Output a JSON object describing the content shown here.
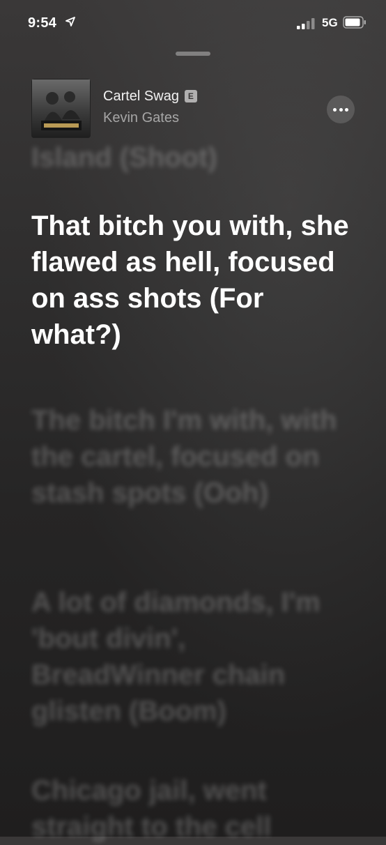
{
  "status_bar": {
    "time": "9:54",
    "network": "5G"
  },
  "now_playing": {
    "title": "Cartel Swag",
    "explicit_badge": "E",
    "artist": "Kevin Gates"
  },
  "icons": {
    "more": "ellipsis-icon",
    "location": "location-arrow-icon",
    "signal": "signal-bars-icon",
    "battery": "battery-icon"
  },
  "lyrics": [
    {
      "text": "Island (Shoot)"
    },
    {
      "text": "That bitch you with, she flawed as hell, focused on ass shots (For what?)"
    },
    {
      "text": "The bitch I'm with, with the cartel, focused on stash spots (Ooh)"
    },
    {
      "text": "A lot of diamonds, I'm 'bout divin', BreadWinner chain glisten (Boom)"
    },
    {
      "text": "Chicago jail, went straight to the cell"
    }
  ]
}
